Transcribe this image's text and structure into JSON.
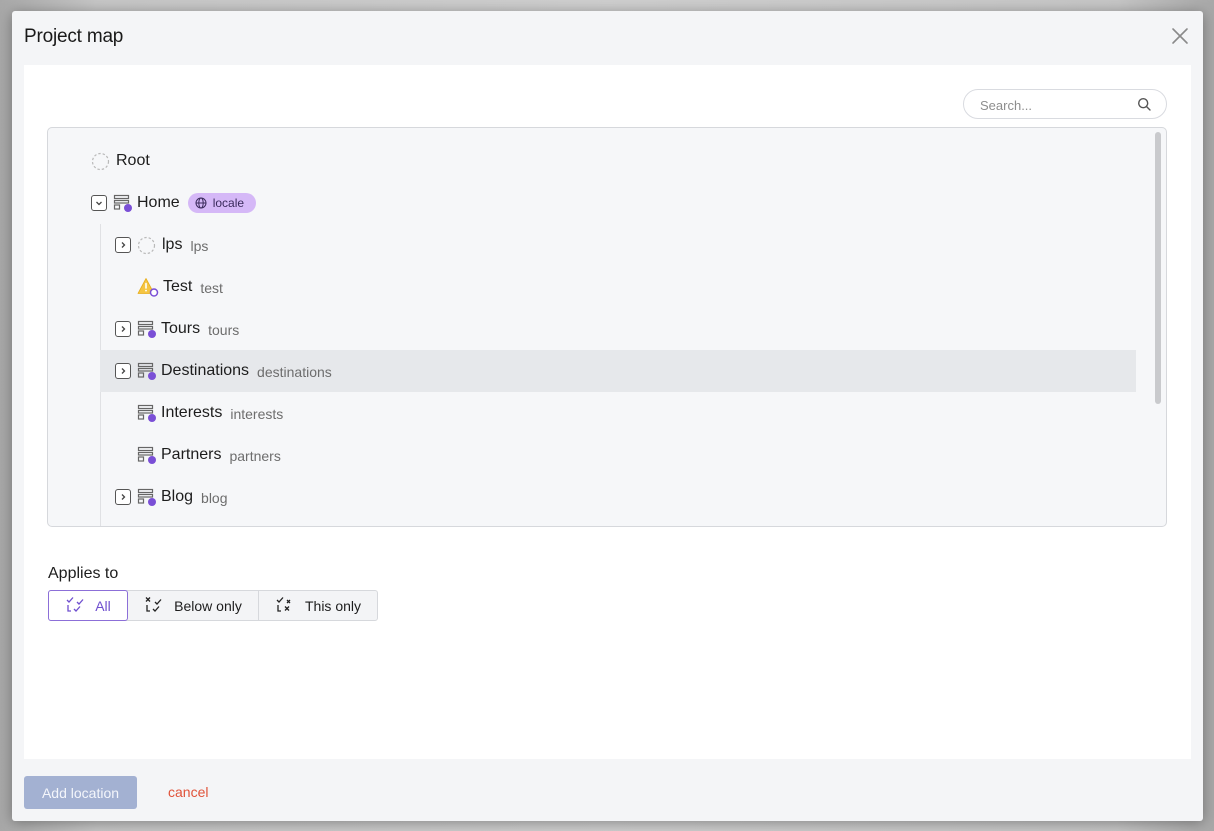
{
  "dialog": {
    "title": "Project map"
  },
  "search": {
    "placeholder": "Search..."
  },
  "tree": {
    "root": {
      "label": "Root"
    },
    "home": {
      "label": "Home",
      "badge": "locale"
    },
    "children": [
      {
        "label": "lps",
        "slug": "lps"
      },
      {
        "label": "Test",
        "slug": "test"
      },
      {
        "label": "Tours",
        "slug": "tours"
      },
      {
        "label": "Destinations",
        "slug": "destinations"
      },
      {
        "label": "Interests",
        "slug": "interests"
      },
      {
        "label": "Partners",
        "slug": "partners"
      },
      {
        "label": "Blog",
        "slug": "blog"
      }
    ]
  },
  "applies_to": {
    "label": "Applies to",
    "options": [
      "All",
      "Below only",
      "This only"
    ],
    "selected": "All"
  },
  "footer": {
    "add_label": "Add location",
    "cancel_label": "cancel"
  },
  "colors": {
    "accent_purple": "#7a4fd6",
    "badge_bg": "#d5b8f7",
    "warning_yellow": "#f5c542",
    "cancel_red": "#e0533a",
    "primary_disabled": "#a3b1d2"
  }
}
